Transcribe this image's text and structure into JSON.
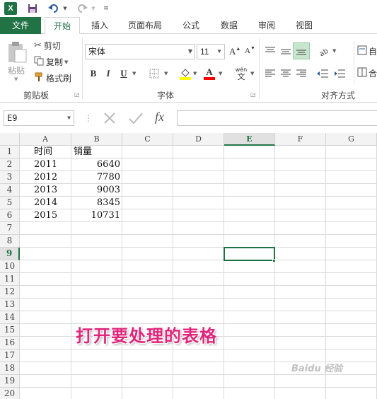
{
  "qat": {
    "logo": "X",
    "save_icon": "save-icon",
    "undo_icon": "undo-icon",
    "redo_icon": "redo-icon"
  },
  "tabs": [
    {
      "label": "文件"
    },
    {
      "label": "开始"
    },
    {
      "label": "插入"
    },
    {
      "label": "页面布局"
    },
    {
      "label": "公式"
    },
    {
      "label": "数据"
    },
    {
      "label": "审阅"
    },
    {
      "label": "视图"
    }
  ],
  "ribbon": {
    "clipboard": {
      "paste_label": "粘贴",
      "cut_label": "剪切",
      "copy_label": "复制",
      "format_painter_label": "格式刷",
      "group_label": "剪贴板"
    },
    "font": {
      "font_name": "宋体",
      "font_size": "11",
      "grow_label": "A",
      "shrink_label": "A",
      "bold": "B",
      "italic": "I",
      "underline": "U",
      "font_color_glyph": "A",
      "wen_label": "wén",
      "wen_char": "文",
      "group_label": "字体"
    },
    "alignment": {
      "group_label": "对齐方式",
      "wrap_label": "自",
      "merge_label": "合"
    }
  },
  "formula_bar": {
    "name_box": "E9",
    "fx_label": "fx",
    "formula": ""
  },
  "columns": [
    "A",
    "B",
    "C",
    "D",
    "E",
    "F",
    "G"
  ],
  "rows": [
    "1",
    "2",
    "3",
    "4",
    "5",
    "6",
    "7",
    "8",
    "9",
    "10",
    "11",
    "12",
    "13",
    "14",
    "15",
    "16",
    "17",
    "18",
    "19",
    "20"
  ],
  "cells": {
    "header": {
      "a": "时间",
      "b": "销量"
    },
    "data": [
      {
        "year": "2011",
        "sales": "6640"
      },
      {
        "year": "2012",
        "sales": "7780"
      },
      {
        "year": "2013",
        "sales": "9003"
      },
      {
        "year": "2014",
        "sales": "8345"
      },
      {
        "year": "2015",
        "sales": "10731"
      }
    ]
  },
  "selection": {
    "cell": "E9",
    "color": "#217346"
  },
  "annotation": "打开要处理的表格",
  "watermark": "Baidu 经验",
  "colors": {
    "accent": "#217346",
    "annotation": "#e0247a",
    "fill_yellow": "#ffff00",
    "font_red": "#ff0000"
  }
}
